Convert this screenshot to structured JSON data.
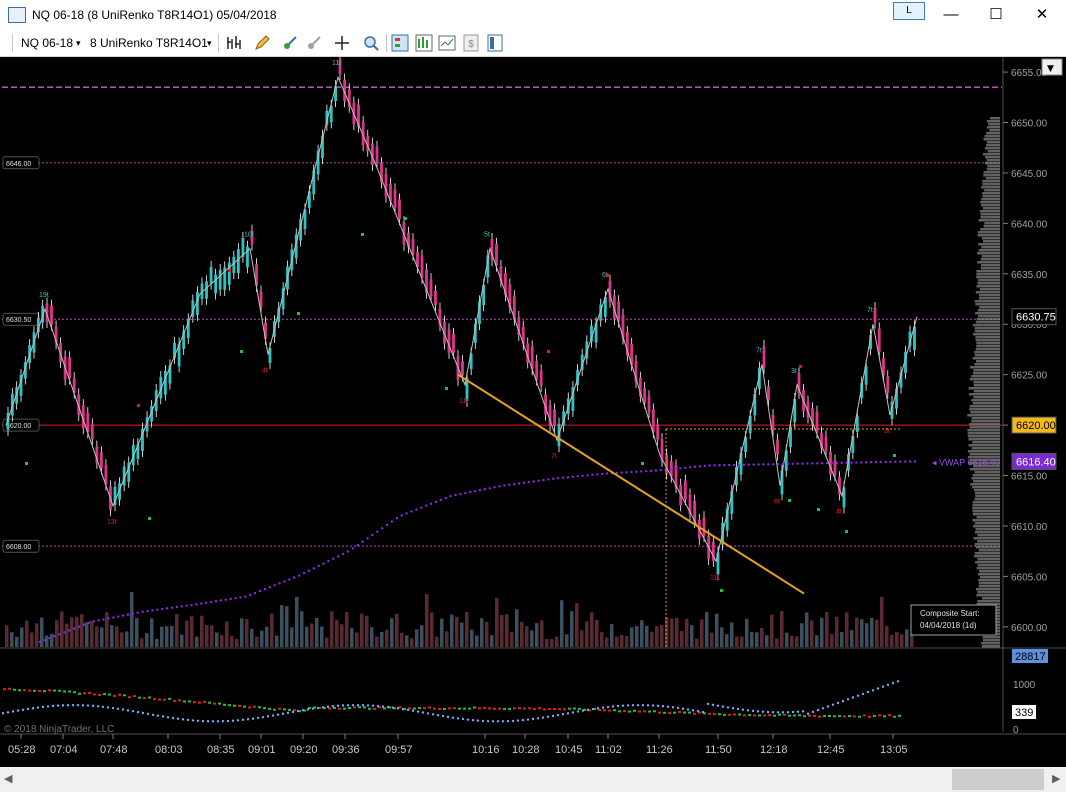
{
  "window": {
    "title": "NQ 06-18 (8 UniRenko T8R14O1)  05/04/2018",
    "link_button": "L",
    "minimize": "—",
    "maximize": "☐",
    "close": "✕"
  },
  "toolbar": {
    "instrument": "NQ 06-18",
    "instrument_arrow": "▾",
    "bar_type": "8 UniRenko T8R14O1",
    "bar_type_arrow": "▾",
    "icons": [
      "bar-style-icon",
      "draw-pencil-icon",
      "strategy-icon",
      "indicator-icon",
      "crosshair-icon",
      "zoom-icon",
      "chart-trader-icon",
      "data-box-icon",
      "templates-icon",
      "properties-icon",
      "window-layout-icon"
    ]
  },
  "colors": {
    "up_candle": "#2ec4c4",
    "down_candle": "#e0338a",
    "wick": "#ffffff",
    "swing_line": "#c0c0c0",
    "vwap": "#8a2be2",
    "trendline": "#e8a020",
    "level_red": "#e02020",
    "level_purple": "#b050b0",
    "dot_green": "#20c040",
    "dot_red": "#e02020"
  },
  "price_axis": {
    "ticks": [
      "6655.00",
      "6650.00",
      "6645.00",
      "6640.00",
      "6635.00",
      "6630.00",
      "6625.00",
      "6620.00",
      "6615.00",
      "6610.00",
      "6605.00",
      "6600.00"
    ],
    "last_price": "6630.75",
    "level_price": "6620.00",
    "vwap_price": "6616.40",
    "vwap_label": "◂ VWAP  6616.40"
  },
  "left_levels": [
    "6646.00",
    "6630.50",
    "6620.00",
    "6608.00"
  ],
  "swing_labels": [
    {
      "text": "19t",
      "color": "teal"
    },
    {
      "text": "13t",
      "color": "red"
    },
    {
      "text": "10t",
      "color": "teal"
    },
    {
      "text": "4t",
      "color": "red"
    },
    {
      "text": "11t",
      "color": "teal"
    },
    {
      "text": "11t",
      "color": "red"
    },
    {
      "text": "5t",
      "color": "teal"
    },
    {
      "text": "7t",
      "color": "red"
    },
    {
      "text": "6t",
      "color": "teal"
    },
    {
      "text": "11t",
      "color": "red"
    },
    {
      "text": "7t",
      "color": "teal"
    },
    {
      "text": "6t",
      "color": "red"
    },
    {
      "text": "3t",
      "color": "teal"
    },
    {
      "text": "4t",
      "color": "red"
    },
    {
      "text": "7t",
      "color": "teal"
    },
    {
      "text": "3t",
      "color": "red"
    }
  ],
  "time_axis": [
    "05:28",
    "07:04",
    "07:48",
    "08:03",
    "08:35",
    "09:01",
    "09:20",
    "09:36",
    "09:57",
    "10:16",
    "10:28",
    "10:45",
    "11:02",
    "11:26",
    "11:50",
    "12:18",
    "12:45",
    "13:05"
  ],
  "composite_box": {
    "line1": "Composite Start:",
    "line2": "04/04/2018 (1d)"
  },
  "lower_panel": {
    "ticks": [
      "1000",
      "0"
    ],
    "badge_top": "28817",
    "badge_bottom": "339"
  },
  "copyright": "© 2018 NinjaTrader, LLC",
  "chart_data": {
    "type": "candlestick",
    "title": "NQ 06-18 (8 UniRenko T8R14O1)",
    "y_range": [
      6598,
      6656
    ],
    "swing_points": [
      {
        "time_index": 0,
        "price": 6620
      },
      {
        "time_index": 1,
        "price": 6631.5
      },
      {
        "time_index": 2,
        "price": 6612
      },
      {
        "time_index": 3,
        "price": 6633
      },
      {
        "time_index": 4,
        "price": 6637.5
      },
      {
        "time_index": 5,
        "price": 6627
      },
      {
        "time_index": 6,
        "price": 6654.5
      },
      {
        "time_index": 7,
        "price": 6646
      },
      {
        "time_index": 8,
        "price": 6624
      },
      {
        "time_index": 9,
        "price": 6637.5
      },
      {
        "time_index": 10,
        "price": 6618.5
      },
      {
        "time_index": 11,
        "price": 6633.5
      },
      {
        "time_index": 12,
        "price": 6617
      },
      {
        "time_index": 13,
        "price": 6606.5
      },
      {
        "time_index": 14,
        "price": 6626
      },
      {
        "time_index": 15,
        "price": 6614
      },
      {
        "time_index": 16,
        "price": 6624
      },
      {
        "time_index": 17,
        "price": 6613
      },
      {
        "time_index": 18,
        "price": 6630
      },
      {
        "time_index": 19,
        "price": 6621
      },
      {
        "time_index": 20,
        "price": 6630.75
      }
    ],
    "vwap_series": [
      6598.5,
      6600.5,
      6601.5,
      6602.2,
      6603,
      6605,
      6607.5,
      6611,
      6613,
      6614,
      6614.7,
      6615.2,
      6615.5,
      6616,
      6616.1,
      6616.2,
      6616.3,
      6616.4
    ],
    "horizontal_levels": [
      6653.5,
      6646,
      6630.5,
      6620,
      6608
    ],
    "trendline": {
      "start_price": 6625,
      "end_price": 6603.3
    }
  }
}
